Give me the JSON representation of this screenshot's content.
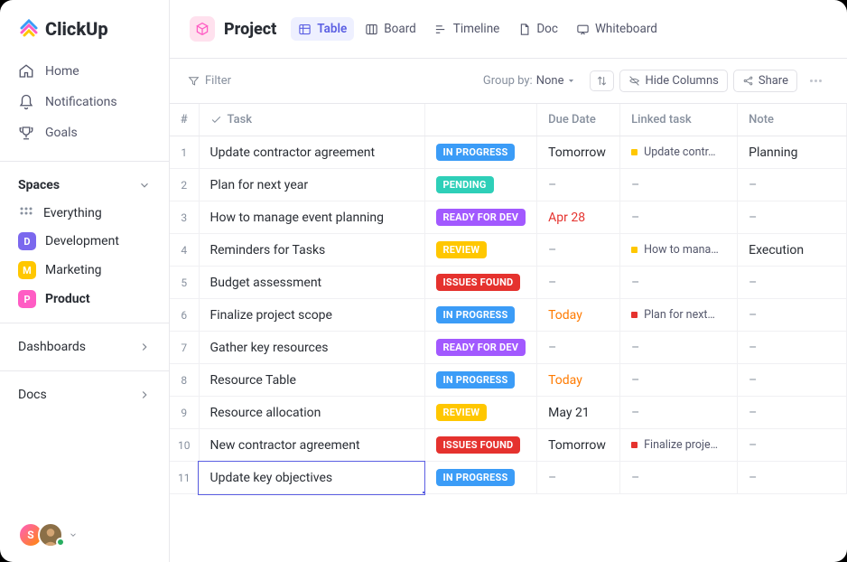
{
  "brand": "ClickUp",
  "sidebar": {
    "nav": [
      {
        "label": "Home",
        "icon": "home"
      },
      {
        "label": "Notifications",
        "icon": "bell"
      },
      {
        "label": "Goals",
        "icon": "trophy"
      }
    ],
    "spaces_title": "Spaces",
    "everything_label": "Everything",
    "spaces": [
      {
        "letter": "D",
        "label": "Development",
        "color": "#7b68ee"
      },
      {
        "letter": "M",
        "label": "Marketing",
        "color": "#ffc700"
      },
      {
        "letter": "P",
        "label": "Product",
        "color": "#ff5cc4",
        "active": true
      }
    ],
    "dashboards_label": "Dashboards",
    "docs_label": "Docs",
    "user_initial": "S"
  },
  "topbar": {
    "title": "Project",
    "views": [
      {
        "label": "Table",
        "icon": "table",
        "active": true
      },
      {
        "label": "Board",
        "icon": "board"
      },
      {
        "label": "Timeline",
        "icon": "timeline"
      },
      {
        "label": "Doc",
        "icon": "doc"
      },
      {
        "label": "Whiteboard",
        "icon": "whiteboard"
      }
    ]
  },
  "toolbar": {
    "filter": "Filter",
    "group_by_label": "Group by:",
    "group_by_value": "None",
    "hide_columns": "Hide Columns",
    "share": "Share"
  },
  "table": {
    "columns": [
      "#",
      "Task",
      "",
      "Due Date",
      "Linked task",
      "Note"
    ],
    "rows": [
      {
        "n": "1",
        "task": "Update contractor agreement",
        "status": "IN PROGRESS",
        "status_cls": "st-inprogress",
        "due": "Tomorrow",
        "due_cls": "",
        "linked": {
          "text": "Update contr…",
          "color": "#ffc700"
        },
        "note": "Planning"
      },
      {
        "n": "2",
        "task": "Plan for next year",
        "status": "PENDING",
        "status_cls": "st-pending",
        "due": "–",
        "due_cls": "dash",
        "linked": null,
        "note": "–"
      },
      {
        "n": "3",
        "task": "How to manage event planning",
        "status": "READY FOR DEV",
        "status_cls": "st-ready",
        "due": "Apr 28",
        "due_cls": "due-red",
        "linked": null,
        "note": "–"
      },
      {
        "n": "4",
        "task": "Reminders for Tasks",
        "status": "REVIEW",
        "status_cls": "st-review",
        "due": "–",
        "due_cls": "dash",
        "linked": {
          "text": "How to mana…",
          "color": "#ffc700"
        },
        "note": "Execution"
      },
      {
        "n": "5",
        "task": "Budget assessment",
        "status": "ISSUES FOUND",
        "status_cls": "st-issues",
        "due": "–",
        "due_cls": "dash",
        "linked": null,
        "note": "–"
      },
      {
        "n": "6",
        "task": "Finalize project scope",
        "status": "IN PROGRESS",
        "status_cls": "st-inprogress",
        "due": "Today",
        "due_cls": "due-orange",
        "linked": {
          "text": "Plan for next…",
          "color": "#e5322e"
        },
        "note": "–"
      },
      {
        "n": "7",
        "task": "Gather key resources",
        "status": "READY FOR DEV",
        "status_cls": "st-ready",
        "due": "–",
        "due_cls": "dash",
        "linked": null,
        "note": "–"
      },
      {
        "n": "8",
        "task": "Resource Table",
        "status": "IN PROGRESS",
        "status_cls": "st-inprogress",
        "due": "Today",
        "due_cls": "due-orange",
        "linked": null,
        "note": "–"
      },
      {
        "n": "9",
        "task": "Resource allocation",
        "status": "REVIEW",
        "status_cls": "st-review",
        "due": "May 21",
        "due_cls": "",
        "linked": null,
        "note": "–"
      },
      {
        "n": "10",
        "task": "New contractor agreement",
        "status": "ISSUES FOUND",
        "status_cls": "st-issues",
        "due": "Tomorrow",
        "due_cls": "",
        "linked": {
          "text": "Finalize proje…",
          "color": "#e5322e"
        },
        "note": "–"
      },
      {
        "n": "11",
        "task": "Update key objectives",
        "status": "IN PROGRESS",
        "status_cls": "st-inprogress",
        "due": "–",
        "due_cls": "dash",
        "linked": null,
        "note": "–",
        "editing": true
      }
    ]
  }
}
